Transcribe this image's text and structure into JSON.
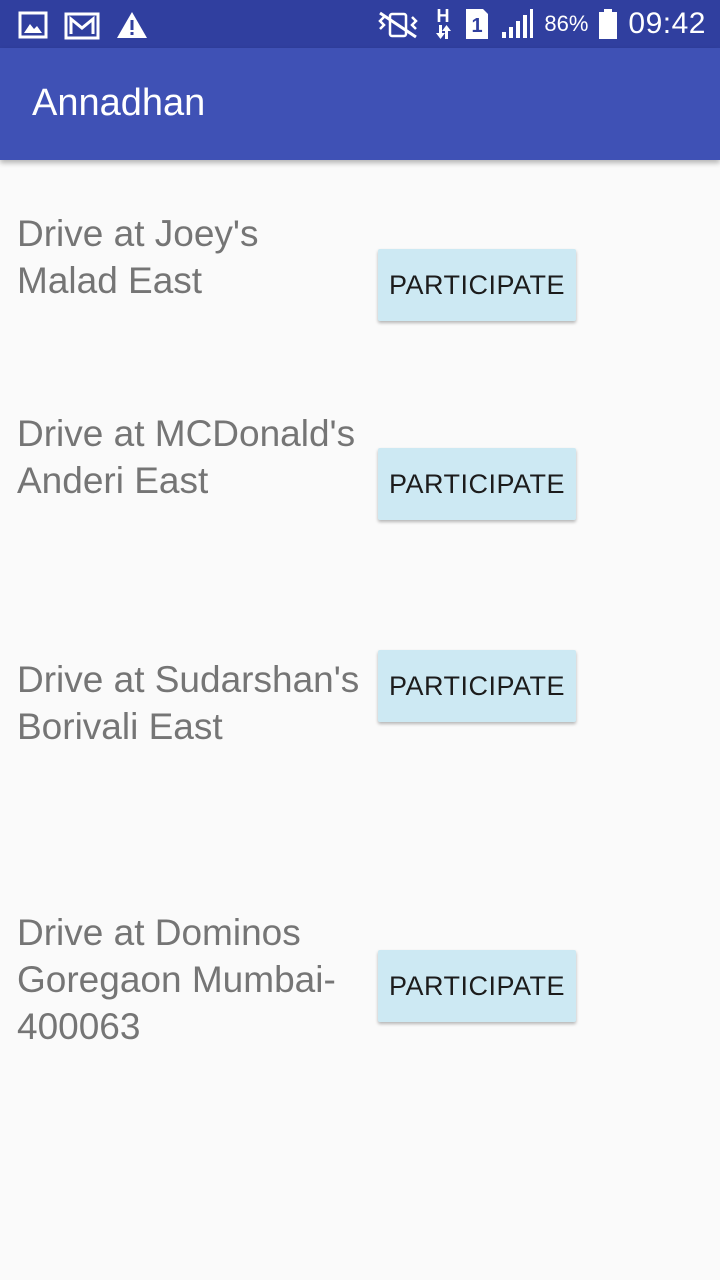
{
  "status_bar": {
    "battery": "86%",
    "time": "09:42",
    "sim_slot": "1",
    "network": "H",
    "icons": [
      "gallery-icon",
      "gmail-icon",
      "warning-icon",
      "vibrate-icon",
      "network-h-icon",
      "sim-icon",
      "signal-icon",
      "battery-icon"
    ]
  },
  "app_bar": {
    "title": "Annadhan"
  },
  "drives": [
    {
      "text": "Drive at Joey's\nMalad East",
      "button": "PARTICIPATE"
    },
    {
      "text": "Drive at MCDonald's\nAnderi East",
      "button": "PARTICIPATE"
    },
    {
      "text": "Drive at Sudarshan's\nBorivali East",
      "button": "PARTICIPATE"
    },
    {
      "text": "Drive at Dominos\nGoregaon Mumbai-\n400063",
      "button": "PARTICIPATE"
    }
  ],
  "colors": {
    "status_bar": "#303f9f",
    "app_bar": "#3f51b5",
    "background": "#fafafa",
    "button": "#cde9f3",
    "drive_text": "#757575"
  }
}
